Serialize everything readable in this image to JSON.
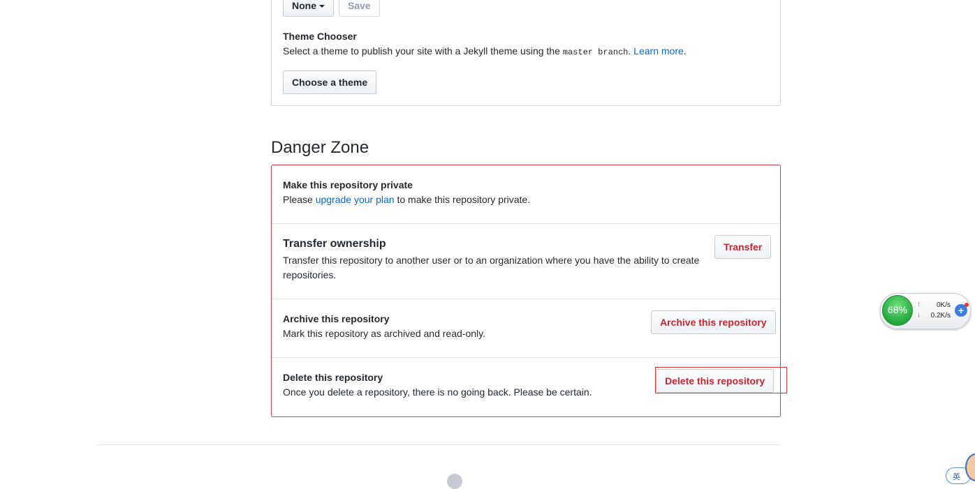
{
  "pages_source": {
    "select_value": "None",
    "save_label": "Save"
  },
  "theme": {
    "heading": "Theme Chooser",
    "desc_before": "Select a theme to publish your site with a Jekyll theme using the",
    "branch_code": "master branch",
    "period": ".",
    "learn_more": "Learn more",
    "end": ".",
    "button": "Choose a theme"
  },
  "danger": {
    "title": "Danger Zone",
    "private": {
      "heading": "Make this repository private",
      "pre": "Please",
      "link": "upgrade your plan",
      "post": "to make this repository private."
    },
    "transfer": {
      "heading": "Transfer ownership",
      "line1": "Transfer this repository to another user or to an organization where you have the ability to create",
      "line2": "repositories.",
      "button": "Transfer"
    },
    "archive": {
      "heading": "Archive this repository",
      "desc": "Mark this repository as archived and read-only.",
      "button": "Archive this repository"
    },
    "delete": {
      "heading": "Delete this repository",
      "desc": "Once you delete a repository, there is no going back. Please be certain.",
      "button": "Delete this repository"
    }
  },
  "widget": {
    "percent": "68%",
    "upload": "0K/s",
    "download": "0.2K/s"
  },
  "footer": {
    "ime_label": "英"
  },
  "colors": {
    "danger": "#cb2431",
    "link": "#0366d6",
    "widget_green": "#2fbf4a"
  }
}
